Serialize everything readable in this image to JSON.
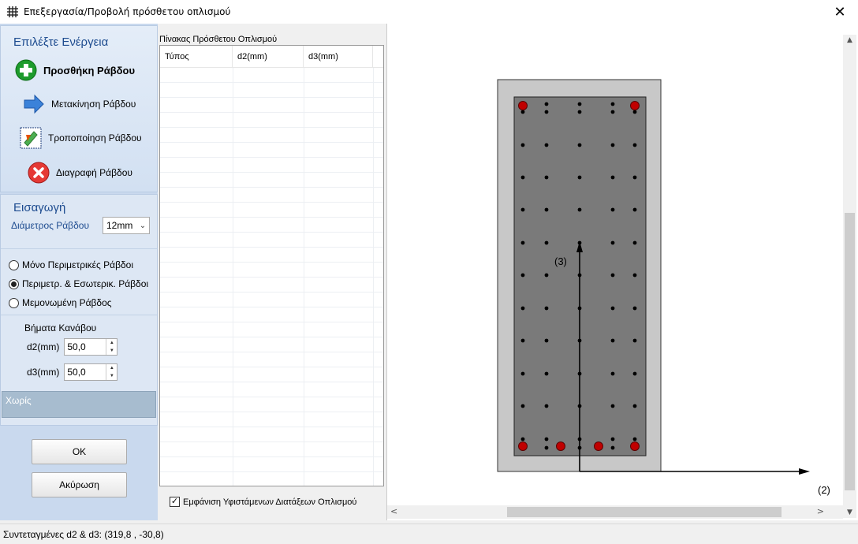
{
  "window": {
    "title": "Επεξεργασία/Προβολή πρόσθετου οπλισμού",
    "close_glyph": "✕"
  },
  "actions": {
    "title": "Επιλέξτε Ενέργεια",
    "items": [
      {
        "label": "Προσθήκη Ράβδου",
        "icon": "add-icon"
      },
      {
        "label": "Μετακίνηση Ράβδου",
        "icon": "arrow-right-icon"
      },
      {
        "label": "Τροποποίηση Ράβδου",
        "icon": "edit-icon"
      },
      {
        "label": "Διαγραφή Ράβδου",
        "icon": "delete-icon"
      }
    ]
  },
  "insert": {
    "title": "Εισαγωγή",
    "diameter_label": "Διάμετρος Ράβδου",
    "diameter_value": "12mm",
    "options": [
      {
        "label": "Μόνο Περιμετρικές Ράβδοι",
        "selected": false
      },
      {
        "label": "Περιμετρ. & Εσωτερικ. Ράβδοι",
        "selected": true
      },
      {
        "label": "Μεμονωμένη Ράβδος",
        "selected": false
      }
    ],
    "grid_title": "Βήματα Κανάβου",
    "d2_label": "d2(mm)",
    "d2_value": "50,0",
    "d3_label": "d3(mm)",
    "d3_value": "50,0"
  },
  "status_box": "Χωρίς",
  "buttons": {
    "ok": "OK",
    "cancel": "Ακύρωση"
  },
  "table": {
    "caption": "Πίνακας Πρόσθετου Οπλισμού",
    "columns": [
      "Τύπος",
      "d2(mm)",
      "d3(mm)"
    ]
  },
  "show_existing": {
    "label": "Εμφάνιση Υφιστάμενων Διατάξεων Οπλισμού",
    "checked": true
  },
  "drawing": {
    "axis3_label": "(3)",
    "axis2_label": "(2)",
    "colors": {
      "section": "#c8c8c8",
      "core": "#7a7a7a",
      "rebar": "#c00000",
      "dot": "#000000"
    }
  },
  "statusbar": {
    "text": "Συντεταγμένες d2 & d3: (319,8 , -30,8)"
  }
}
